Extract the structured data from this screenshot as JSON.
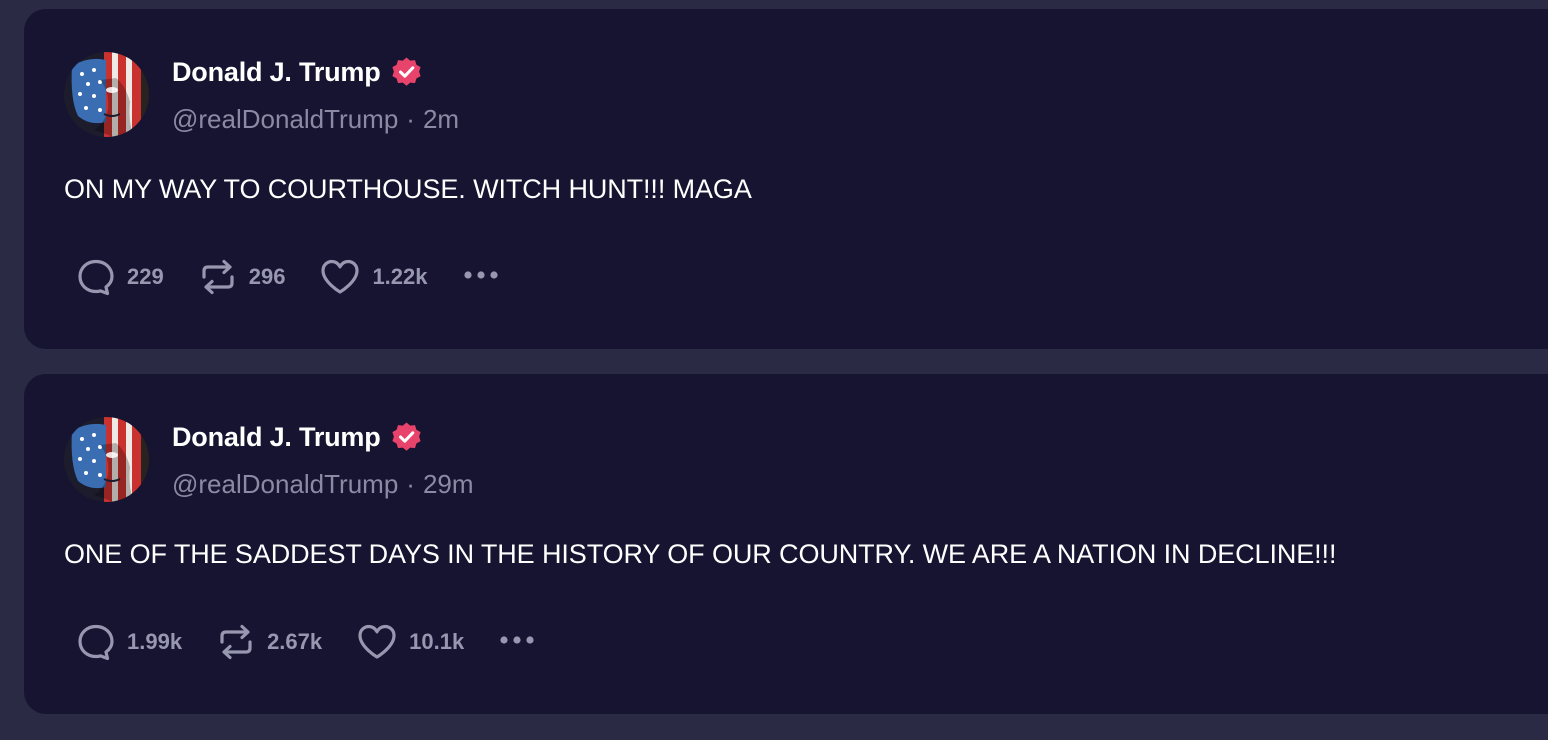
{
  "colors": {
    "page_background": "#2a2a45",
    "card_background": "#161431",
    "verified_badge": "#e8436a",
    "muted_text": "#8b8aa3",
    "primary_text": "#ffffff"
  },
  "icons": {
    "reply": "speech-bubble-icon",
    "repost": "repost-arrows-icon",
    "like": "heart-icon",
    "more": "ellipsis-icon",
    "verified": "verified-badge-icon"
  },
  "posts": [
    {
      "author": {
        "display_name": "Donald J. Trump",
        "handle": "@realDonaldTrump"
      },
      "separator": "·",
      "time": "2m",
      "text": "ON MY WAY TO COURTHOUSE. WITCH HUNT!!! MAGA",
      "stats": {
        "replies": "229",
        "reposts": "296",
        "likes": "1.22k"
      }
    },
    {
      "author": {
        "display_name": "Donald J. Trump",
        "handle": "@realDonaldTrump"
      },
      "separator": "·",
      "time": "29m",
      "text": "ONE OF THE SADDEST DAYS IN THE HISTORY OF OUR COUNTRY. WE ARE A NATION IN DECLINE!!!",
      "stats": {
        "replies": "1.99k",
        "reposts": "2.67k",
        "likes": "10.1k"
      }
    }
  ]
}
